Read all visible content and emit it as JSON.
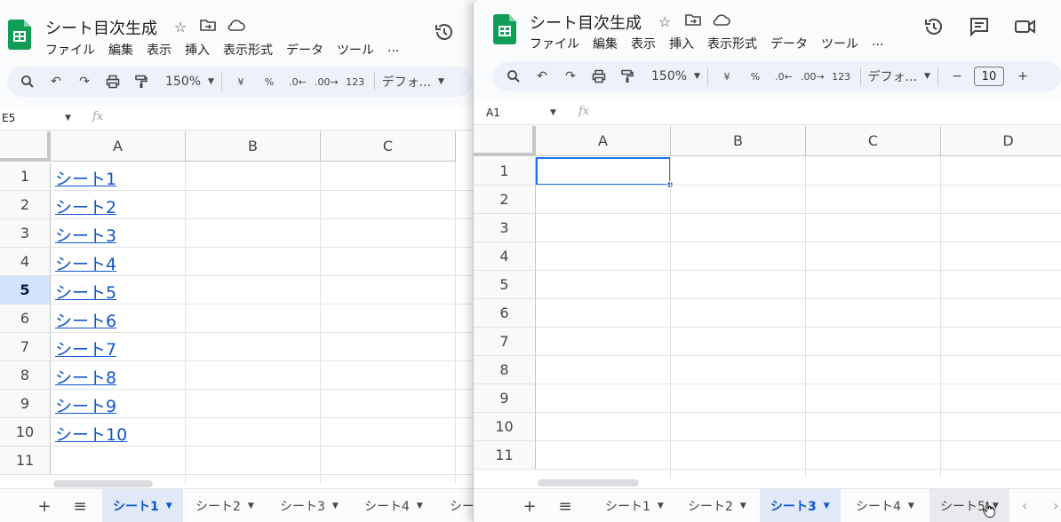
{
  "left_window": {
    "doc_title": "シート目次生成",
    "menu": [
      "ファイル",
      "編集",
      "表示",
      "挿入",
      "表示形式",
      "データ",
      "ツール",
      "..."
    ],
    "toolbar": {
      "zoom": "150%",
      "currency": "¥",
      "percent": "%",
      "dec_less": ".0",
      "dec_more": ".00",
      "number_format": "123",
      "font": "デフォ..."
    },
    "name_box": "E5",
    "fx": "fx",
    "columns": [
      "A",
      "B",
      "C"
    ],
    "rows": [
      "1",
      "2",
      "3",
      "4",
      "5",
      "6",
      "7",
      "8",
      "9",
      "10",
      "11"
    ],
    "active_row": "5",
    "links": [
      "シート1",
      "シート2",
      "シート3",
      "シート4",
      "シート5",
      "シート6",
      "シート7",
      "シート8",
      "シート9",
      "シート10"
    ],
    "tabs": [
      "シート1",
      "シート2",
      "シート3",
      "シート4",
      "シー"
    ],
    "active_tab": "シート1"
  },
  "right_window": {
    "doc_title": "シート目次生成",
    "menu": [
      "ファイル",
      "編集",
      "表示",
      "挿入",
      "表示形式",
      "データ",
      "ツール",
      "..."
    ],
    "toolbar": {
      "zoom": "150%",
      "currency": "¥",
      "percent": "%",
      "dec_less": ".0",
      "dec_more": ".00",
      "number_format": "123",
      "font": "デフォ...",
      "font_size": "10",
      "minus": "−",
      "plus": "+"
    },
    "name_box": "A1",
    "fx": "fx",
    "columns": [
      "A",
      "B",
      "C",
      "D"
    ],
    "rows": [
      "1",
      "2",
      "3",
      "4",
      "5",
      "6",
      "7",
      "8",
      "9",
      "10",
      "11"
    ],
    "tabs": [
      "シート1",
      "シート2",
      "シート3",
      "シート4",
      "シート5"
    ],
    "active_tab": "シート3",
    "hovered_tab": "シート5"
  },
  "icons": {
    "star": "star-icon",
    "folder": "move-folder-icon",
    "cloud": "cloud-status-icon",
    "history": "history-icon",
    "comment": "comment-icon",
    "meet": "video-call-icon",
    "search": "search-icon",
    "undo": "undo-icon",
    "redo": "redo-icon",
    "print": "print-icon",
    "paint": "paint-format-icon",
    "add": "add-sheet-icon",
    "list": "all-sheets-icon"
  },
  "colors": {
    "link": "#1155cc",
    "accent": "#1a73e8",
    "sheets_green": "#0f9d58",
    "active_tab": "#0b57d0"
  }
}
